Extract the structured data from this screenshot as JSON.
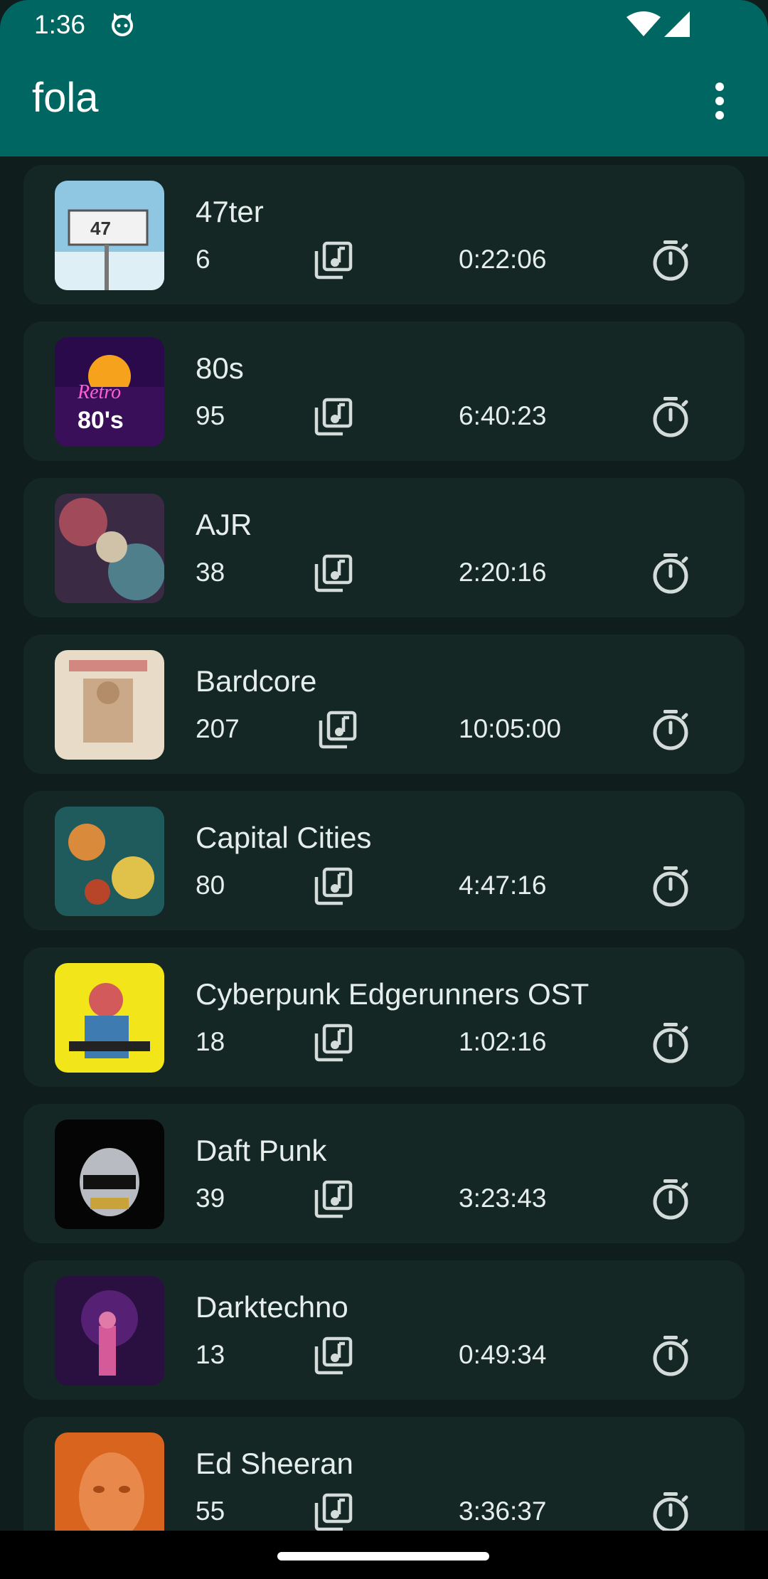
{
  "status_bar": {
    "time": "1:36"
  },
  "app_bar": {
    "title": "fola"
  },
  "playlists": [
    {
      "title": "47ter",
      "count": "6",
      "duration": "0:22:06"
    },
    {
      "title": "80s",
      "count": "95",
      "duration": "6:40:23"
    },
    {
      "title": "AJR",
      "count": "38",
      "duration": "2:20:16"
    },
    {
      "title": "Bardcore",
      "count": "207",
      "duration": "10:05:00"
    },
    {
      "title": "Capital Cities",
      "count": "80",
      "duration": "4:47:16"
    },
    {
      "title": "Cyberpunk Edgerunners OST",
      "count": "18",
      "duration": "1:02:16"
    },
    {
      "title": "Daft Punk",
      "count": "39",
      "duration": "3:23:43"
    },
    {
      "title": "Darktechno",
      "count": "13",
      "duration": "0:49:34"
    },
    {
      "title": "Ed Sheeran",
      "count": "55",
      "duration": "3:36:37"
    }
  ],
  "icons": {
    "track_count": "music-library-icon",
    "duration": "stopwatch-icon",
    "menu": "more-vert-icon"
  },
  "colors": {
    "app_bar": "#006661",
    "background": "#0f1d1c",
    "card": "#152725",
    "text": "#e6eeec"
  }
}
